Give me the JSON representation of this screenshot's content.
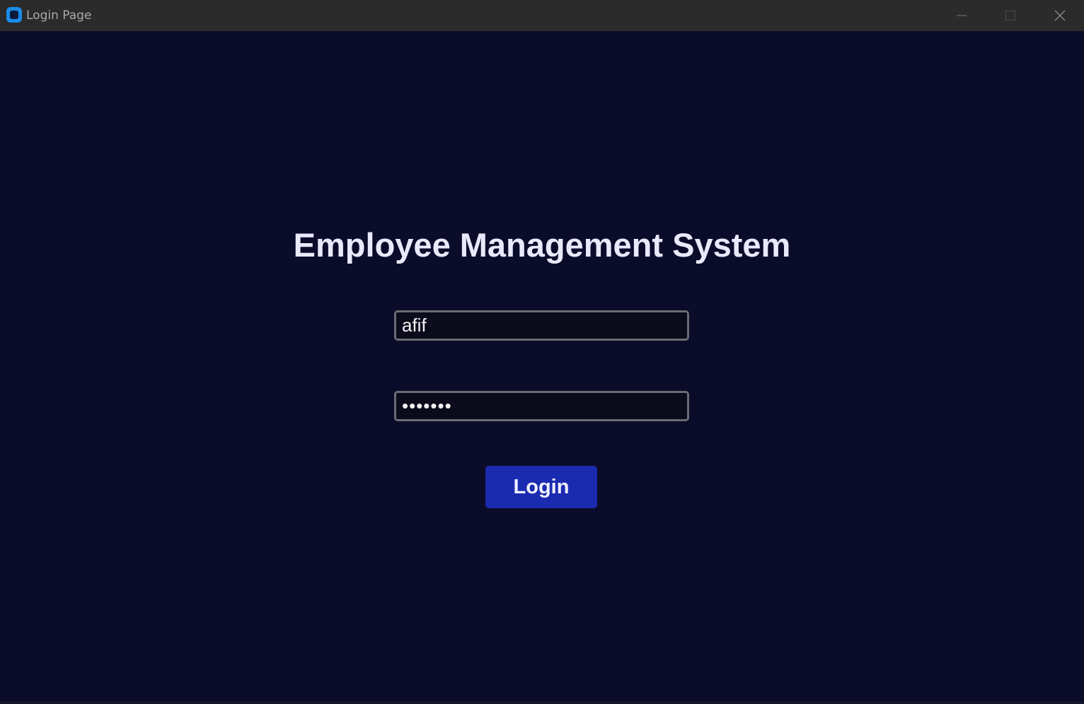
{
  "window": {
    "title": "Login Page",
    "app_icon": "app-logo-icon",
    "controls": {
      "minimize_icon": "minimize-icon",
      "maximize_icon": "maximize-icon",
      "close_icon": "close-icon"
    }
  },
  "login_form": {
    "heading": "Employee Management System",
    "username_value": "afif",
    "password_value": "1234567",
    "login_label": "Login"
  },
  "colors": {
    "background": "#0b0c2a",
    "titlebar": "#2b2b2b",
    "accent_button": "#1b2bb0",
    "app_icon_blue": "#1a8ce8"
  }
}
